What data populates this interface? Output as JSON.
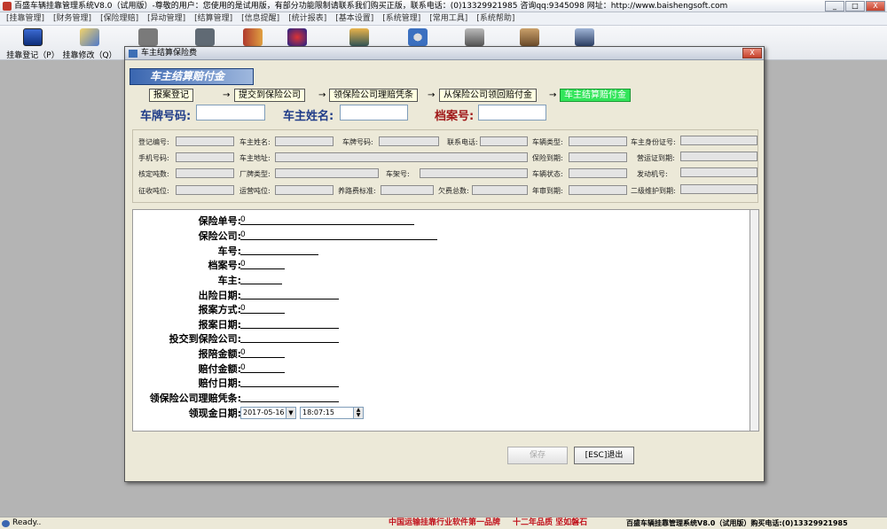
{
  "window": {
    "title": "百盛车辆挂靠管理系统V8.0（试用版）-尊敬的用户：您使用的是试用版，有部分功能限制请联系我们购买正版，联系电话：(0)13329921985 咨询qq:9345098 网址：http://www.baishengsoft.com",
    "minimize": "_",
    "maximize": "□",
    "close": "X"
  },
  "menu": [
    "[挂靠管理]",
    "[财务管理]",
    "[保险理赔]",
    "[异动管理]",
    "[结算管理]",
    "[信息提醒]",
    "[统计报表]",
    "[基本设置]",
    "[系统管理]",
    "[常用工具]",
    "[系统帮助]"
  ],
  "toolbar": [
    {
      "label": "挂靠登记（P）",
      "icon": "monitor-icon"
    },
    {
      "label": "挂靠修改（Q）",
      "icon": "edit-book-icon"
    },
    {
      "label": "",
      "icon": "document-stack-icon"
    },
    {
      "label": "",
      "icon": "database-icon"
    },
    {
      "label": "",
      "icon": "book-icon"
    },
    {
      "label": "",
      "icon": "user-icon"
    },
    {
      "label": "",
      "icon": "group-icon"
    },
    {
      "label": "",
      "icon": "gear-icon"
    },
    {
      "label": "",
      "icon": "lock-icon"
    },
    {
      "label": "",
      "icon": "calculator-icon"
    },
    {
      "label": "",
      "icon": "disk-icon"
    }
  ],
  "dialog": {
    "title": "车主结算保险费",
    "banner": "车主结算赔付金",
    "close": "X",
    "steps": [
      "报案登记",
      "提交到保险公司",
      "领保险公司理赔凭条",
      "从保险公司领回赔付金",
      "车主结算赔付金"
    ],
    "arrow": "→",
    "top_fields": [
      {
        "label": "车牌号码:",
        "value": ""
      },
      {
        "label": "车主姓名:",
        "value": ""
      },
      {
        "label": "档案号:",
        "value": ""
      }
    ],
    "info_labels": {
      "r1": [
        "登记编号:",
        "车主姓名:",
        "车牌号码:",
        "联系电话:",
        "车辆类型:",
        "车主身份证号:"
      ],
      "r2": [
        "手机号码:",
        "车主地址:",
        "保险到期:",
        "营运证到期:"
      ],
      "r3": [
        "核定吨数:",
        "厂牌类型:",
        "车架号:",
        "车辆状态:",
        "发动机号:"
      ],
      "r4": [
        "征收吨位:",
        "运营吨位:",
        "养路费标准:",
        "欠费总数:",
        "年审到期:",
        "二级维护到期:"
      ]
    },
    "details": [
      {
        "label": "保险单号:",
        "value": "0"
      },
      {
        "label": "保险公司:",
        "value": "0"
      },
      {
        "label": "车号:",
        "value": ""
      },
      {
        "label": "档案号:",
        "value": "0"
      },
      {
        "label": "车主:",
        "value": ""
      },
      {
        "label": "出险日期:",
        "value": ""
      },
      {
        "label": "报案方式:",
        "value": "0"
      },
      {
        "label": "报案日期:",
        "value": ""
      },
      {
        "label": "投交到保险公司:",
        "value": ""
      },
      {
        "label": "报陪金额:",
        "value": "0"
      },
      {
        "label": "赔付金额:",
        "value": "0"
      },
      {
        "label": "赔付日期:",
        "value": ""
      },
      {
        "label": "领保险公司理赔凭条:",
        "value": ""
      },
      {
        "label": "领现金日期:",
        "value": ""
      }
    ],
    "date_value": "2017-05-16",
    "time_value": "18:07:15",
    "save_label": "保存",
    "exit_label": "[ESC]退出"
  },
  "status": {
    "left": "Ready..",
    "middle": "中国运输挂靠行业软件第一品牌",
    "middle2": "十二年品质 坚如磐石",
    "right": "百盛车辆挂靠管理系统V8.0（试用版）购买电话:(0)13329921985"
  },
  "colors": {
    "current_step": "#32e55a",
    "banner": "#3a66b0",
    "label_blue": "#1f3c88",
    "label_red": "#a01818"
  }
}
